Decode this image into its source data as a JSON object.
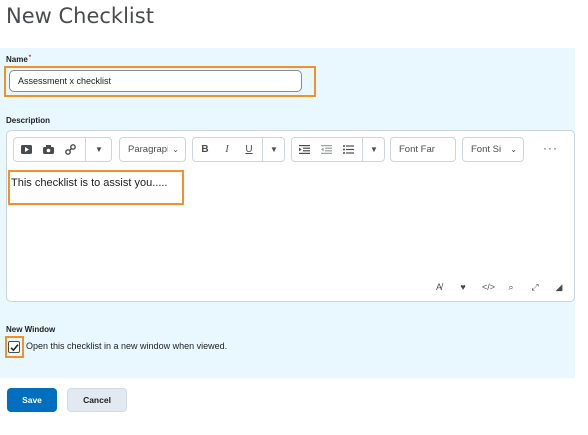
{
  "page": {
    "title": "New Checklist"
  },
  "form": {
    "name_label": "Name",
    "required_marker": "*",
    "name_value": "Assessment x checklist",
    "description_label": "Description",
    "description_text": "This checklist is to assist you.....",
    "new_window_label": "New Window",
    "new_window_checkbox_label": "Open this checklist in a new window when viewed.",
    "new_window_checked": true
  },
  "toolbar": {
    "insert_stuff_icon": "video-icon",
    "insert_quicklink_icon": "quicklink-icon",
    "insert_link_icon": "link-icon",
    "paragraph_select": "Paragraph",
    "bold_label": "B",
    "italic_label": "I",
    "underline_label": "U",
    "font_family_select": "Font Family",
    "font_size_select": "Font Size",
    "more_label": "···"
  },
  "actions": {
    "save_label": "Save",
    "cancel_label": "Cancel"
  },
  "colors": {
    "panel_bg": "#e9f8ff",
    "highlight": "#f0912b",
    "primary": "#006fbf"
  }
}
